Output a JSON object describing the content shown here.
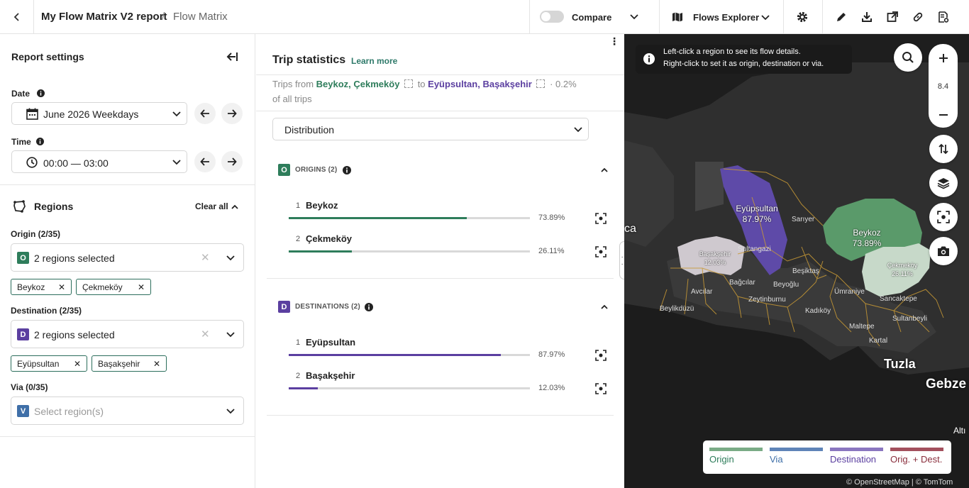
{
  "header": {
    "report_title": "My Flow Matrix V2 report",
    "separator": "/",
    "breadcrumb": "Flow Matrix",
    "compare_label": "Compare",
    "explorer_label": "Flows Explorer"
  },
  "left": {
    "title": "Report settings",
    "date_label": "Date",
    "date_value": "June 2026 Weekdays",
    "time_label": "Time",
    "time_value": "00:00 — 03:00",
    "regions_title": "Regions",
    "clear_all": "Clear all",
    "origin_label": "Origin (2/35)",
    "origin_value": "2 regions selected",
    "origin_badge": "O",
    "origin_chips": [
      "Beykoz",
      "Çekmeköy"
    ],
    "destination_label": "Destination (2/35)",
    "destination_value": "2 regions selected",
    "destination_badge": "D",
    "destination_chips": [
      "Eyüpsultan",
      "Başakşehir"
    ],
    "via_label": "Via (0/35)",
    "via_placeholder": "Select region(s)",
    "via_badge": "V"
  },
  "middle": {
    "title": "Trip statistics",
    "learn_more": "Learn more",
    "trips_from": "Trips from",
    "origins_text": "Beykoz, Çekmeköy",
    "to": "to",
    "destinations_text": "Eyüpsultan, Başakşehir",
    "share": "· 0.2%",
    "share_suffix": "of all trips",
    "dropdown_value": "Distribution",
    "origins_section": {
      "badge": "O",
      "title": "ORIGINS (2)",
      "rows": [
        {
          "rank": "1",
          "name": "Beykoz",
          "pct_text": "73.89%",
          "value": 0.7389
        },
        {
          "rank": "2",
          "name": "Çekmeköy",
          "pct_text": "26.11%",
          "value": 0.2611
        }
      ]
    },
    "destinations_section": {
      "badge": "D",
      "title": "DESTINATIONS (2)",
      "rows": [
        {
          "rank": "1",
          "name": "Eyüpsultan",
          "pct_text": "87.97%",
          "value": 0.8797
        },
        {
          "rank": "2",
          "name": "Başakşehir",
          "pct_text": "12.03%",
          "value": 0.1203
        }
      ]
    }
  },
  "map": {
    "info_line1": "Left-click a region to see its flow details.",
    "info_line2": "Right-click to set it as origin, destination or via.",
    "zoom_level": "8.4",
    "region_labels": {
      "eyupsultan": "Eyüpsultan",
      "eyupsultan_pct": "87.97%",
      "basaksehir": "Başakşehir",
      "basaksehir_pct": "12.03%",
      "beykoz": "Beykoz",
      "beykoz_pct": "73.89%",
      "cekmekoy": "Çekmeköy",
      "cekmekoy_pct": "26.11%"
    },
    "place_labels": [
      "Sarıyer",
      "Sultangazi",
      "Beşiktaş",
      "Bağcılar",
      "Beyoğlu",
      "Avcılar",
      "Zeytinburnu",
      "Ümraniye",
      "Sancaktepe",
      "Beylikdüzü",
      "Kadıköy",
      "Maltepe",
      "Sultanbeyli",
      "Kartal"
    ],
    "big_labels": {
      "tuzla": "Tuzla",
      "gebze": "Gebze",
      "ca": "ca",
      "alti": "Altı"
    },
    "legend": [
      "Origin",
      "Via",
      "Destination",
      "Orig. + Dest."
    ],
    "attribution": "© OpenStreetMap | © TomTom"
  },
  "colors": {
    "origin": "#2e7d5b",
    "destination": "#5b3fa0",
    "via": "#3f6fa8",
    "orig_dest": "#8a2e3c",
    "link": "#2f7a6a"
  }
}
